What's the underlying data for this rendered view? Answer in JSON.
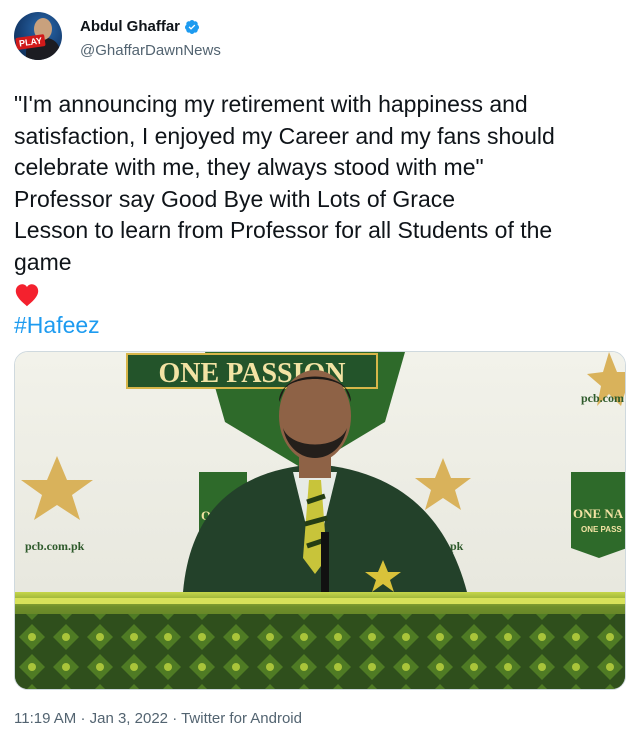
{
  "user": {
    "display_name": "Abdul Ghaffar",
    "handle": "@GhaffarDawnNews",
    "avatar_badge": "PLAY",
    "verified": true
  },
  "tweet": {
    "line1": "\"I'm announcing my retirement with happiness and",
    "line2": "satisfaction, I enjoyed my Career and my fans should",
    "line3": "celebrate with me, they always stood with me\"",
    "line4": "Professor say Good Bye with Lots of Grace",
    "line5": "Lesson to learn from Professor for all Students of the",
    "line6": "game",
    "emoji": "red-heart-icon",
    "hashtag": "#Hafeez"
  },
  "media": {
    "banner_text": "ONE PASSION",
    "sponsor_left": "pcb.com.pk",
    "sponsor_right": "pcb.com",
    "sponsor_mid": ".pk",
    "one_nation_line1": "ONE NA",
    "one_nation_line2": "ONE PASS",
    "center_badge_text": "ON"
  },
  "meta": {
    "time": "11:19 AM",
    "date": "Jan 3, 2022",
    "source": "Twitter for Android",
    "separator": "·"
  },
  "colors": {
    "link": "#1d9bf0",
    "secondary_text": "#536471",
    "verified": "#1d9bf0",
    "heart": "#f4212e"
  }
}
